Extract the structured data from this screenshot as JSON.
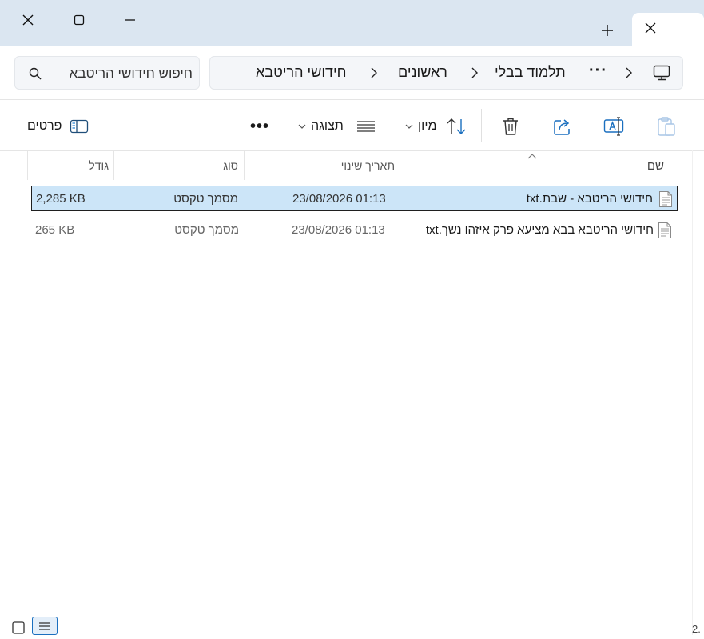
{
  "window": {
    "close_label": "Close",
    "maximize_label": "Maximize",
    "minimize_label": "Minimize",
    "new_tab_label": "New tab",
    "tab_close_label": "Close tab"
  },
  "search": {
    "placeholder": "חיפוש חידושי הריטבא"
  },
  "breadcrumb": {
    "items": [
      "חידושי הריטבא",
      "ראשונים",
      "תלמוד בבלי"
    ],
    "more": "···"
  },
  "toolbar": {
    "details_label": "פרטים",
    "more": "•••",
    "view_label": "תצוגה",
    "sort_label": "מיון"
  },
  "columns": {
    "name": "שם",
    "modified": "תאריך שינוי",
    "type": "סוג",
    "size": "גודל"
  },
  "files": [
    {
      "name": "חידושי הריטבא - שבת.txt",
      "modified": "23/08/2026 01:13",
      "type": "מסמך טקסט",
      "size": "2,285 KB",
      "selected": true
    },
    {
      "name": "חידושי הריטבא בבא מציעא פרק איזהו נשך.txt",
      "modified": "23/08/2026 01:13",
      "type": "מסמך טקסט",
      "size": "265 KB",
      "selected": false
    }
  ],
  "status": {
    "fragment": "2."
  },
  "colors": {
    "titlebar": "#dbe6f1",
    "selection": "#cce5f8",
    "accent": "#1a6fbf"
  }
}
